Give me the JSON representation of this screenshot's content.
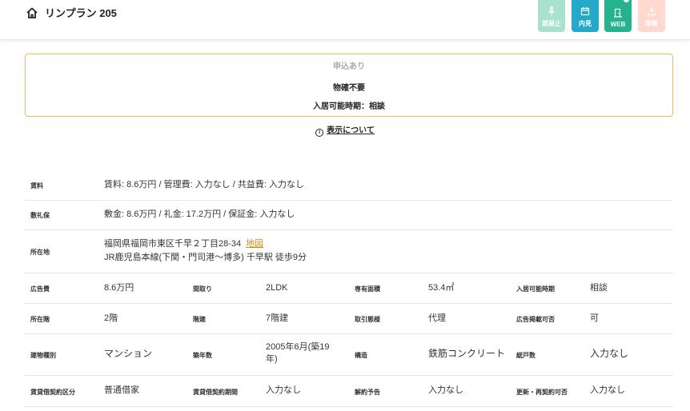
{
  "header": {
    "title": "リンプラン 205",
    "home_icon": "home-icon",
    "actions": [
      {
        "label": "部屋止",
        "icon": "pin-icon",
        "color": "#a9e1cf"
      },
      {
        "label": "内見",
        "icon": "calendar-icon",
        "color": "#25a9c8"
      },
      {
        "label": "WEB",
        "icon": "door-icon",
        "color": "#24b38e"
      },
      {
        "label": "帯替",
        "icon": "download-icon",
        "color": "#ffd9cf"
      }
    ]
  },
  "notice": {
    "status": "申込あり",
    "confirm": "物確不要",
    "movein": "入居可能時期：相談",
    "border_color": "#f5b85a"
  },
  "about": {
    "icon": "info-icon",
    "link_text": "表示について"
  },
  "details": {
    "rent": {
      "label": "賃料",
      "value": "賃料: 8.6万円 / 管理費: 入力なし / 共益費: 入力なし"
    },
    "deposit": {
      "label": "敷礼保",
      "value": "敷金: 8.6万円 / 礼金: 17.2万円 / 保証金: 入力なし"
    },
    "location": {
      "label": "所在地",
      "address": "福岡県福岡市東区千早２丁目28-34",
      "map_link": "地図",
      "access": "JR鹿児島本線(下関・門司港～博多) 千早駅 徒歩9分"
    },
    "grid": [
      [
        {
          "label": "広告費",
          "value": "8.6万円"
        },
        {
          "label": "間取り",
          "value": "2LDK"
        },
        {
          "label": "専有面積",
          "value": "53.4㎡"
        },
        {
          "label": "入居可能時期",
          "value": "相談"
        }
      ],
      [
        {
          "label": "所在階",
          "value": "2階"
        },
        {
          "label": "階建",
          "value": "7階建"
        },
        {
          "label": "取引態様",
          "value": "代理"
        },
        {
          "label": "広告掲載可否",
          "value": "可"
        }
      ],
      [
        {
          "label": "建物種別",
          "value": "マンション"
        },
        {
          "label": "築年数",
          "value": "2005年6月(築19年)"
        },
        {
          "label": "構造",
          "value": "鉄筋コンクリート"
        },
        {
          "label": "総戸数",
          "value": "入力なし"
        }
      ],
      [
        {
          "label": "賃貸借契約区分",
          "value": "普通借家"
        },
        {
          "label": "賃貸借契約期間",
          "value": "入力なし"
        },
        {
          "label": "解約予告",
          "value": "入力なし"
        },
        {
          "label": "更新・再契約可否",
          "value": "入力なし"
        }
      ]
    ]
  }
}
